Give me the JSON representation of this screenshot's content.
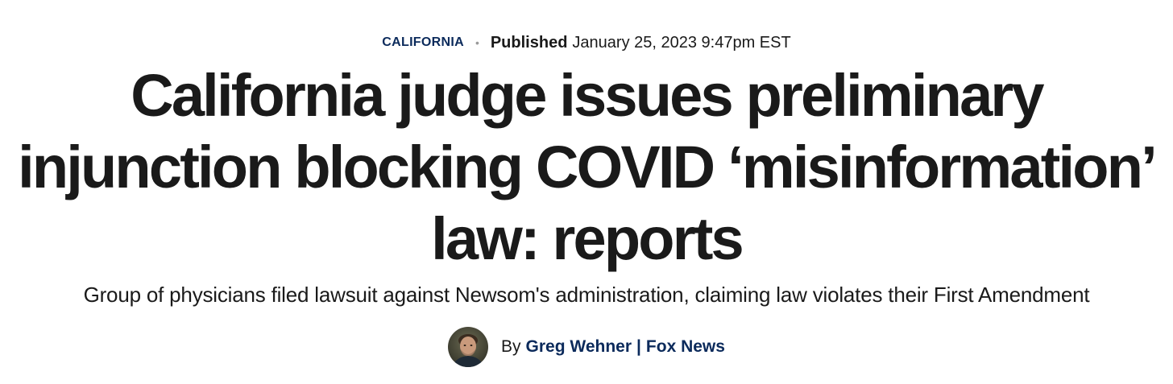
{
  "meta": {
    "category": "CALIFORNIA",
    "published_label": "Published",
    "published_date": "January 25, 2023 9:47pm EST"
  },
  "headline": "California judge issues preliminary injunction blocking COVID ‘misinformation’ law: reports",
  "subhead": "Group of physicians filed lawsuit against Newsom's administration, claiming law violates their First Amendment",
  "byline": {
    "by_label": "By",
    "author": "Greg Wehner",
    "separator": "|",
    "outlet": "Fox News"
  },
  "colors": {
    "link_navy": "#0b2a5b",
    "text": "#1a1a1a",
    "dot": "#9a9a9a"
  }
}
